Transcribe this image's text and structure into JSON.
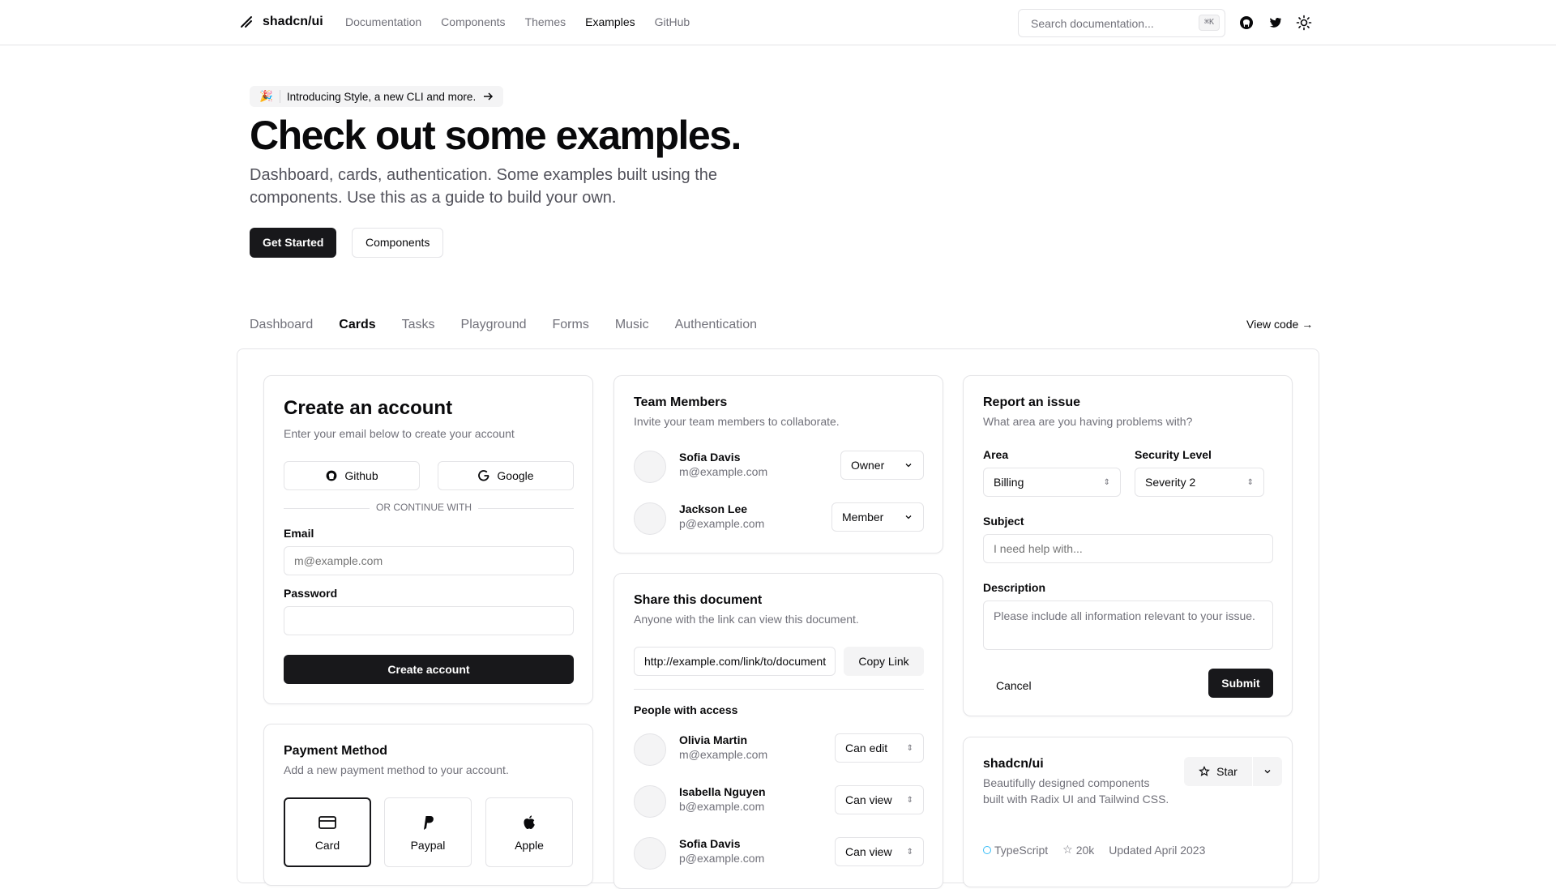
{
  "header": {
    "brand": "shadcn/ui",
    "nav": [
      "Documentation",
      "Components",
      "Themes",
      "Examples",
      "GitHub"
    ],
    "active_nav": "Examples",
    "search_placeholder": "Search documentation...",
    "search_kbd": "⌘K"
  },
  "hero": {
    "announcement_icon": "🎉",
    "announcement": "Introducing Style, a new CLI and more.",
    "title": "Check out some examples.",
    "lead": "Dashboard, cards, authentication. Some examples built using the components. Use this as a guide to build your own.",
    "primary_button": "Get Started",
    "secondary_button": "Components"
  },
  "tabs": {
    "items": [
      "Dashboard",
      "Cards",
      "Tasks",
      "Playground",
      "Forms",
      "Music",
      "Authentication"
    ],
    "active": "Cards",
    "view_code": "View code"
  },
  "create_account": {
    "title": "Create an account",
    "description": "Enter your email below to create your account",
    "github_label": "Github",
    "google_label": "Google",
    "divider": "OR CONTINUE WITH",
    "email_label": "Email",
    "email_placeholder": "m@example.com",
    "password_label": "Password",
    "submit": "Create account"
  },
  "payment": {
    "title": "Payment Method",
    "description": "Add a new payment method to your account.",
    "options": [
      "Card",
      "Paypal",
      "Apple"
    ],
    "selected": "Card"
  },
  "team": {
    "title": "Team Members",
    "description": "Invite your team members to collaborate.",
    "members": [
      {
        "name": "Sofia Davis",
        "email": "m@example.com",
        "role": "Owner"
      },
      {
        "name": "Jackson Lee",
        "email": "p@example.com",
        "role": "Member"
      }
    ]
  },
  "share": {
    "title": "Share this document",
    "description": "Anyone with the link can view this document.",
    "link": "http://example.com/link/to/document",
    "copy_label": "Copy Link",
    "people_heading": "People with access",
    "people": [
      {
        "name": "Olivia Martin",
        "email": "m@example.com",
        "access": "Can edit"
      },
      {
        "name": "Isabella Nguyen",
        "email": "b@example.com",
        "access": "Can view"
      },
      {
        "name": "Sofia Davis",
        "email": "p@example.com",
        "access": "Can view"
      }
    ]
  },
  "report": {
    "title": "Report an issue",
    "description": "What area are you having problems with?",
    "area_label": "Area",
    "area_value": "Billing",
    "security_label": "Security Level",
    "security_value": "Severity 2",
    "subject_label": "Subject",
    "subject_placeholder": "I need help with...",
    "description_label": "Description",
    "description_placeholder": "Please include all information relevant to your issue.",
    "cancel": "Cancel",
    "submit": "Submit"
  },
  "repo": {
    "name": "shadcn/ui",
    "description": "Beautifully designed components built with Radix UI and Tailwind CSS.",
    "star_label": "Star",
    "language": "TypeScript",
    "stars": "20k",
    "updated": "Updated April 2023"
  },
  "colors": {
    "primary": "#18181b",
    "muted": "#71717a",
    "border": "#e4e4e7",
    "language_dot": "#38bdf8"
  }
}
